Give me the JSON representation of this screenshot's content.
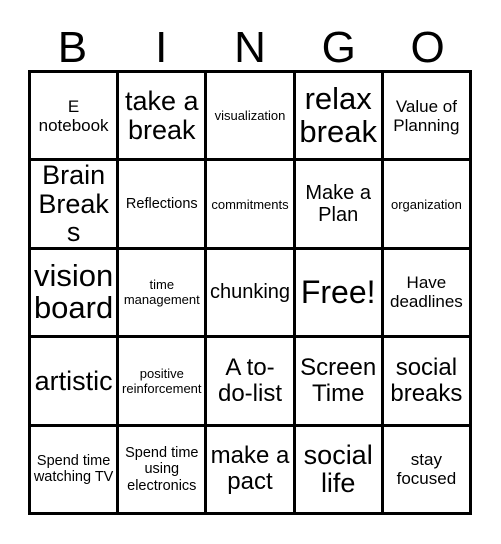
{
  "card": {
    "title_letters": [
      "B",
      "I",
      "N",
      "G",
      "O"
    ],
    "free_space_label": "Free!",
    "colors": {
      "background": "#ffffff",
      "border": "#000000",
      "text": "#000000"
    },
    "grid_size": "5x5"
  },
  "cells": [
    {
      "text": "E notebook",
      "size": "m"
    },
    {
      "text": "take a break",
      "size": "xl"
    },
    {
      "text": "visualization",
      "size": "s"
    },
    {
      "text": "relax break",
      "size": "xxl"
    },
    {
      "text": "Value of Planning",
      "size": "m"
    },
    {
      "text": "Brain Breaks",
      "size": "xl"
    },
    {
      "text": "Reflections",
      "size": "sm"
    },
    {
      "text": "commitments",
      "size": "s"
    },
    {
      "text": "Make a Plan",
      "size": "ml"
    },
    {
      "text": "organization",
      "size": "s"
    },
    {
      "text": "vision board",
      "size": "xxl"
    },
    {
      "text": "time management",
      "size": "s"
    },
    {
      "text": "chunking",
      "size": "ml"
    },
    {
      "text": "Free!",
      "size": "free"
    },
    {
      "text": "Have deadlines",
      "size": "m"
    },
    {
      "text": "artistic",
      "size": "xl"
    },
    {
      "text": "positive reinforcement",
      "size": "s"
    },
    {
      "text": "A to-do-list",
      "size": "l"
    },
    {
      "text": "Screen Time",
      "size": "l"
    },
    {
      "text": "social breaks",
      "size": "l"
    },
    {
      "text": "Spend time watching TV",
      "size": "sm"
    },
    {
      "text": "Spend time using electronics",
      "size": "sm"
    },
    {
      "text": "make a pact",
      "size": "l"
    },
    {
      "text": "social life",
      "size": "xl"
    },
    {
      "text": "stay focused",
      "size": "m"
    }
  ]
}
